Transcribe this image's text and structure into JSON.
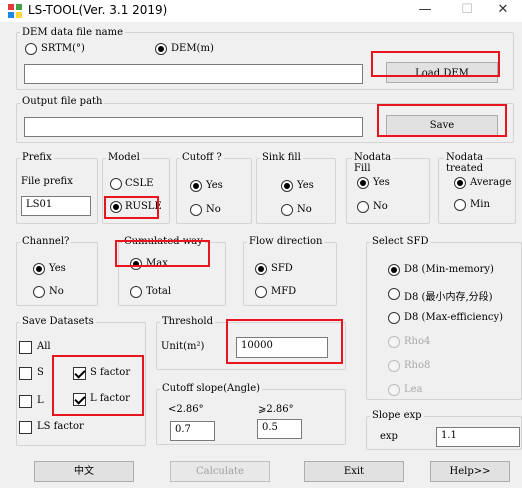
{
  "window": {
    "title": "LS-TOOL(Ver. 3.1 2019)",
    "minimize": "—",
    "maximize": "☐",
    "close": "✕"
  },
  "dem": {
    "legend": "DEM data file name",
    "opt_srtm": "SRTM(°)",
    "opt_dem": "DEM(m)",
    "value": "",
    "load_btn": "Load DEM"
  },
  "output": {
    "legend": "Output file path",
    "value": "",
    "save_btn": "Save"
  },
  "prefix": {
    "legend": "Prefix",
    "label": "File prefix",
    "value": "LS01"
  },
  "model": {
    "legend": "Model",
    "opt_csle": "CSLE",
    "opt_rusle": "RUSLE"
  },
  "cutoff": {
    "legend": "Cutoff ?",
    "yes": "Yes",
    "no": "No"
  },
  "sink": {
    "legend": "Sink fill",
    "yes": "Yes",
    "no": "No"
  },
  "nodata_fill": {
    "legend_1": "Nodata",
    "legend_2": "Fill",
    "yes": "Yes",
    "no": "No"
  },
  "nodata_treated": {
    "legend_1": "Nodata",
    "legend_2": "treated",
    "average": "Average",
    "min": "Min"
  },
  "channel": {
    "legend": "Channel?",
    "yes": "Yes",
    "no": "No"
  },
  "cumulated": {
    "legend": "Cumulated way",
    "max": "Max",
    "total": "Total"
  },
  "flow": {
    "legend": "Flow direction",
    "sfd": "SFD",
    "mfd": "MFD"
  },
  "select_sfd": {
    "legend": "Select SFD",
    "options": [
      "D8 (Min-memory)",
      "D8 (最小内存,分段)",
      "D8 (Max-efficiency)",
      "Rho4",
      "Rho8",
      "Lea"
    ]
  },
  "save_datasets": {
    "legend": "Save Datasets",
    "all": "All",
    "s": "S",
    "l": "L",
    "s_factor": "S factor",
    "l_factor": "L factor",
    "ls_factor": "LS factor"
  },
  "threshold": {
    "legend": "Threshold",
    "unit_label": "Unit(m²)",
    "value": "10000"
  },
  "cutoff_slope": {
    "legend": "Cutoff slope(Angle)",
    "lt_label": "<2.86°",
    "ge_label": "⩾2.86°",
    "lt_value": "0.7",
    "ge_value": "0.5"
  },
  "slope_exp": {
    "legend": "Slope exp",
    "label": "exp",
    "value": "1.1"
  },
  "footer": {
    "chinese": "中文",
    "calculate": "Calculate",
    "exit": "Exit",
    "help": "Help>>"
  }
}
